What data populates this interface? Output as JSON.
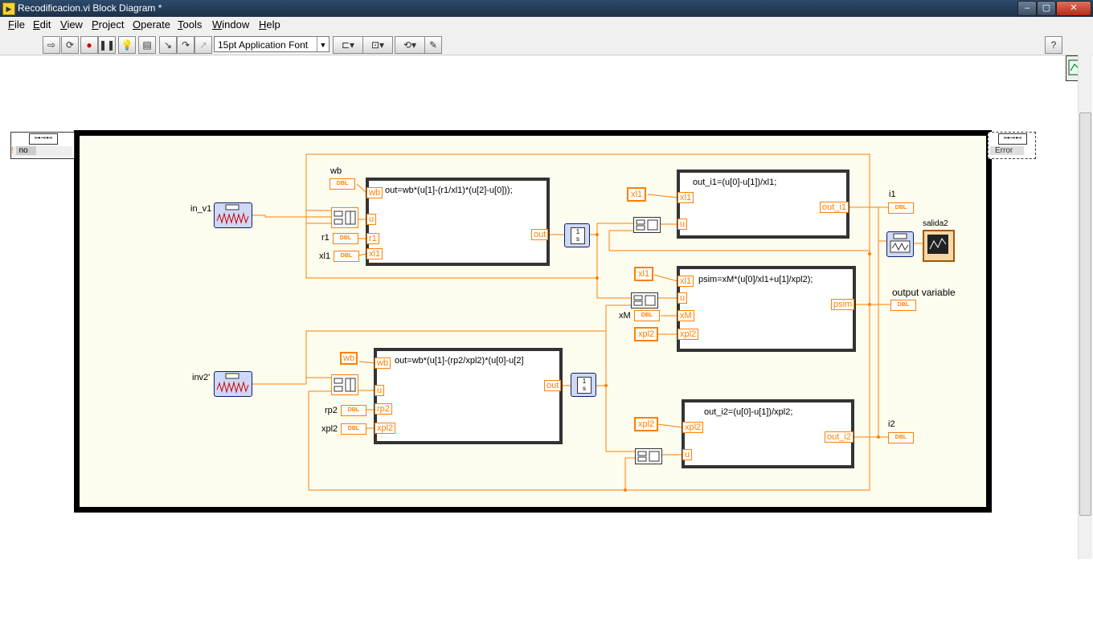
{
  "window": {
    "title": "Recodificacion.vi Block Diagram *"
  },
  "menu": [
    "File",
    "Edit",
    "View",
    "Project",
    "Operate",
    "Tools",
    "Window",
    "Help"
  ],
  "toolbar": {
    "font_select": "15pt Application Font"
  },
  "diagram": {
    "stop_terminal_label": "no",
    "error_terminal_label": "Error",
    "inputs": {
      "in_v1": "in_v1",
      "inv2": "inv2'"
    },
    "constants": {
      "wb": "wb",
      "r1": "r1",
      "xl1": "xl1",
      "rp2": "rp2",
      "xpl2": "xpl2",
      "xM": "xM",
      "dbl": "DBL"
    },
    "formula1": {
      "expr": "out=wb*(u[1]-(r1/xl1)*(u[2]-u[0]));",
      "in_wb": "wb",
      "in_u": "u",
      "in_r1": "r1",
      "in_xl1": "xl1",
      "out": "out"
    },
    "formula2": {
      "expr": "out=wb*(u[1]-(rp2/xpl2)*(u[0]-u[2]",
      "in_wb": "wb",
      "in_u": "u",
      "in_rp2": "rp2",
      "in_xpl2": "xpl2",
      "out": "out"
    },
    "formula3": {
      "expr": "out_i1=(u[0]-u[1])/xl1;",
      "in_xl1": "xl1",
      "in_u": "u",
      "out": "out_i1"
    },
    "formula4": {
      "expr": "psim=xM*(u[0]/xl1+u[1]/xpl2);",
      "in_xl1": "xl1",
      "in_u": "u",
      "in_xM": "xM",
      "in_xpl2": "xpl2",
      "out": "psim"
    },
    "formula5": {
      "expr": "out_i2=(u[0]-u[1])/xpl2;",
      "in_xpl2": "xpl2",
      "in_u": "u",
      "out": "out_i2"
    },
    "integrator": {
      "top": "1",
      "bottom": "s"
    },
    "wb_const2": "wb",
    "xl1_const_a": "xl1",
    "xl1_const_b": "xl1",
    "xpl2_const_a": "xpl2",
    "xpl2_const_b": "xpl2",
    "outputs": {
      "i1": "i1",
      "salida2": "salida2",
      "output_variable": "output variable",
      "i2": "i2"
    }
  },
  "colors": {
    "wire": "#ff8000",
    "loop_border": "#000000",
    "loop_bg": "#fcfcef"
  }
}
